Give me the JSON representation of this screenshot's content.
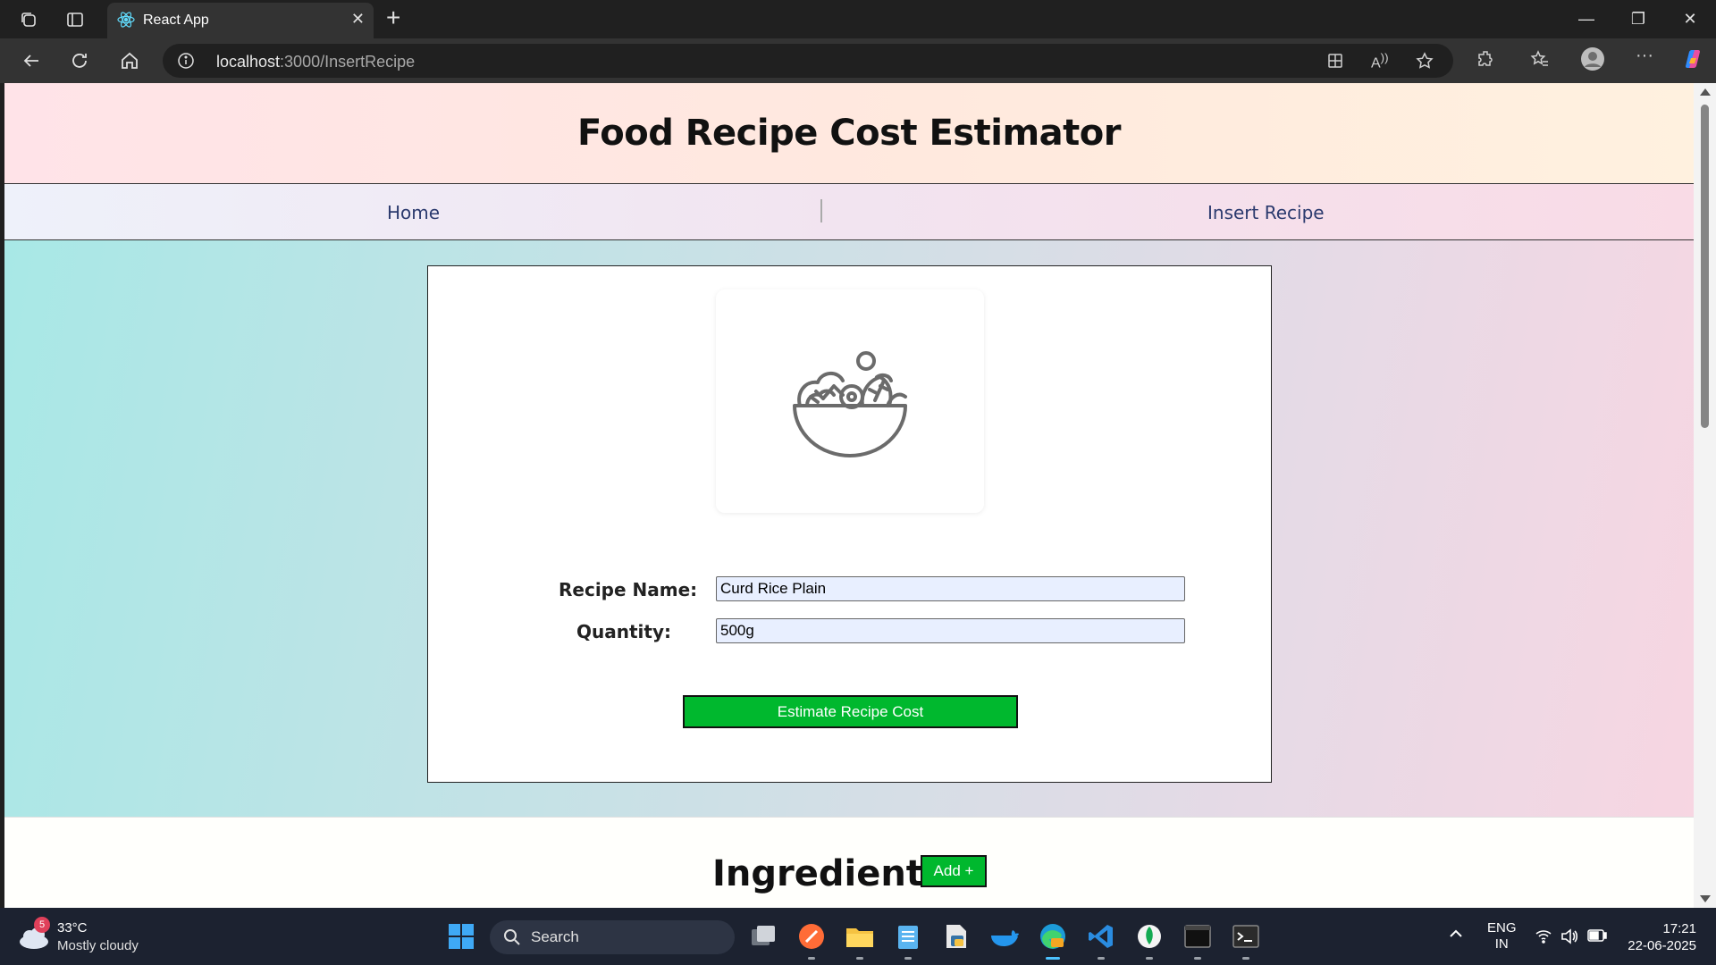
{
  "browser": {
    "tab_title": "React App",
    "url_host": "localhost",
    "url_path": ":3000/InsertRecipe"
  },
  "page": {
    "header_title": "Food Recipe Cost Estimator",
    "nav": {
      "home": "Home",
      "insert_recipe": "Insert Recipe"
    },
    "form": {
      "recipe_name_label": "Recipe Name:",
      "recipe_name_value": "Curd Rice Plain",
      "quantity_label": "Quantity:",
      "quantity_value": "500g",
      "estimate_button": "Estimate Recipe Cost"
    },
    "ingredients": {
      "title": "Ingredients",
      "add_button": "Add +"
    }
  },
  "taskbar": {
    "weather_badge": "5",
    "weather_temp": "33°C",
    "weather_desc": "Mostly cloudy",
    "search_label": "Search",
    "lang_top": "ENG",
    "lang_bottom": "IN",
    "time": "17:21",
    "date": "22-06-2025"
  },
  "colors": {
    "accent_green": "#00b82e",
    "nav_link": "#2b3a6e"
  }
}
